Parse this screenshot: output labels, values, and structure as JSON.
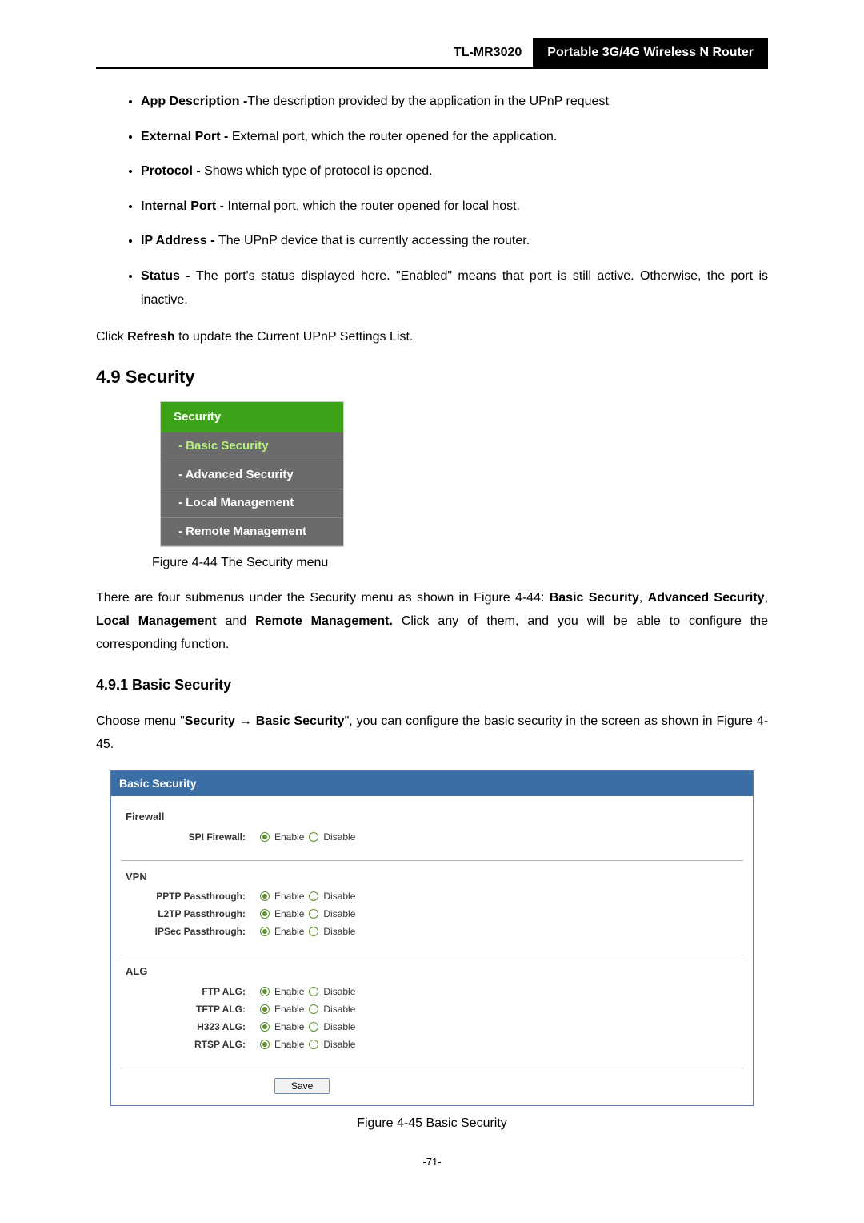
{
  "header": {
    "model": "TL-MR3020",
    "title": "Portable 3G/4G Wireless N Router"
  },
  "bullets": [
    {
      "term": "App Description -",
      "desc": "The description provided by the application in the UPnP request"
    },
    {
      "term": "External Port - ",
      "desc": "External port, which the router opened for the application."
    },
    {
      "term": "Protocol - ",
      "desc": "Shows which type of protocol is opened."
    },
    {
      "term": "Internal Port - ",
      "desc": "Internal port, which the router opened for local host."
    },
    {
      "term": "IP Address - ",
      "desc": "The UPnP device that is currently accessing the router."
    },
    {
      "term": "Status - ",
      "desc": "The port's status displayed here. \"Enabled\" means that port is still active. Otherwise, the port is inactive."
    }
  ],
  "refresh_text": {
    "pre": "Click ",
    "bold": "Refresh",
    "post": " to update the Current UPnP Settings List."
  },
  "section": {
    "num_title": "4.9  Security"
  },
  "menu": {
    "head": "Security",
    "items": [
      "- Basic Security",
      "- Advanced Security",
      "- Local Management",
      "- Remote Management"
    ]
  },
  "fig44": "Figure 4-44    The Security menu",
  "para_submenus": {
    "pre": "There are four submenus under the Security menu as shown in Figure 4-44: ",
    "b1": "Basic Security",
    "s1": ", ",
    "b2": "Advanced Security",
    "s2": ", ",
    "b3": "Local Management",
    "s3": " and ",
    "b4": "Remote Management.",
    "post": " Click any of them, and you will be able to configure the corresponding function."
  },
  "subsection": "4.9.1    Basic Security",
  "para_basic": {
    "p1": "Choose menu \"",
    "b1": "Security",
    "arrow": " → ",
    "b2": "Basic Security",
    "p2": "\", you can configure the basic security in the screen as shown in Figure 4-45."
  },
  "panel": {
    "title": "Basic Security",
    "opt_enable": "Enable",
    "opt_disable": "Disable",
    "groups": [
      {
        "title": "Firewall",
        "rows": [
          {
            "label": "SPI Firewall:"
          }
        ]
      },
      {
        "title": "VPN",
        "rows": [
          {
            "label": "PPTP Passthrough:"
          },
          {
            "label": "L2TP Passthrough:"
          },
          {
            "label": "IPSec Passthrough:"
          }
        ]
      },
      {
        "title": "ALG",
        "rows": [
          {
            "label": "FTP ALG:"
          },
          {
            "label": "TFTP ALG:"
          },
          {
            "label": "H323 ALG:"
          },
          {
            "label": "RTSP ALG:"
          }
        ]
      }
    ],
    "save": "Save"
  },
  "fig45": "Figure 4-45    Basic Security",
  "page_number": "-71-"
}
